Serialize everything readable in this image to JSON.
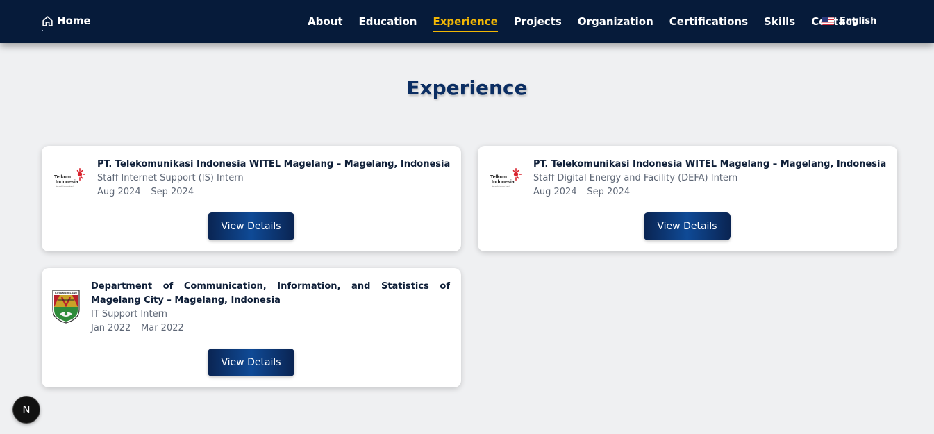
{
  "nav": {
    "home_label": "Home",
    "links": [
      "About",
      "Education",
      "Experience",
      "Projects",
      "Organization",
      "Certifications",
      "Skills",
      "Contact"
    ],
    "active_link": "Experience",
    "language_label": "English",
    "active_color": "#f2b705",
    "bg_color": "#061b3a"
  },
  "page": {
    "title": "Experience"
  },
  "experiences": [
    {
      "company": "PT. Telekomunikasi Indonesia WITEL Magelang – Magelang, Indonesia",
      "role": "Staff Internet Support (IS) Intern",
      "dates": "Aug 2024 – Sep 2024",
      "button_label": "View Details",
      "logo": "telkom-indonesia-logo"
    },
    {
      "company": "PT. Telekomunikasi Indonesia WITEL Magelang – Magelang, Indonesia",
      "role": "Staff Digital Energy and Facility (DEFA) Intern",
      "dates": "Aug 2024 – Sep 2024",
      "button_label": "View Details",
      "logo": "telkom-indonesia-logo"
    },
    {
      "company": "Department of Communication, Information, and Statistics of Magelang City – Magelang, Indonesia",
      "role": "IT Support Intern",
      "dates": "Jan 2022 – Mar 2022",
      "button_label": "View Details",
      "logo": "kota-magelang-logo"
    }
  ],
  "logos": {
    "telkom_text_1": "Telkom",
    "telkom_text_2": "Indonesia",
    "telkom_tagline": "the world in your hand",
    "magelang_text": "KOTA MAGELANG"
  },
  "fab": {
    "label": "N"
  }
}
